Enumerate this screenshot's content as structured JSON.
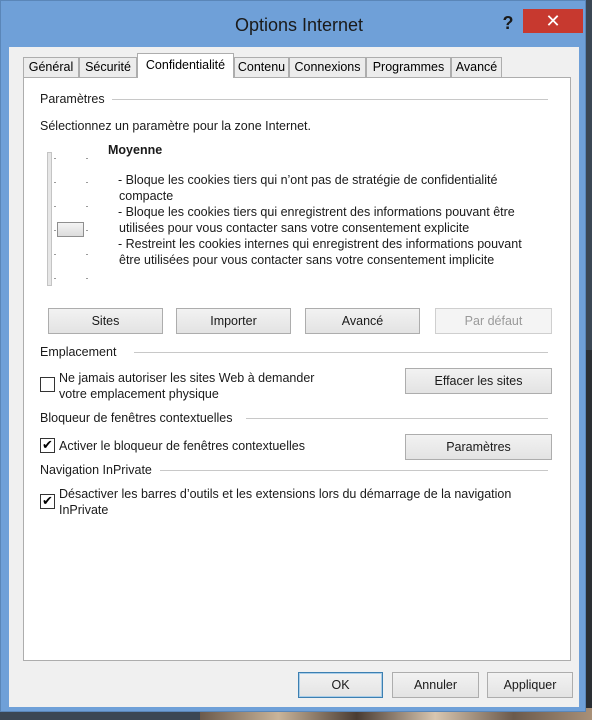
{
  "window": {
    "title": "Options Internet",
    "help_label": "?",
    "close_label": "✕"
  },
  "tabs": [
    {
      "label": "Général"
    },
    {
      "label": "Sécurité"
    },
    {
      "label": "Confidentialité"
    },
    {
      "label": "Contenu"
    },
    {
      "label": "Connexions"
    },
    {
      "label": "Programmes"
    },
    {
      "label": "Avancé"
    }
  ],
  "active_tab": "Confidentialité",
  "settings": {
    "group_label": "Paramètres",
    "instruction": "Sélectionnez un paramètre pour la zone Internet.",
    "level_title": "Moyenne",
    "level_desc": [
      "- Bloque les cookies tiers qui n’ont pas de stratégie de confidentialité",
      "compacte",
      "- Bloque les cookies tiers qui enregistrent des informations pouvant être",
      "utilisées pour vous contacter sans votre consentement explicite",
      "- Restreint les cookies internes qui enregistrent des informations pouvant",
      "être utilisées pour vous contacter sans votre consentement implicite"
    ],
    "buttons": {
      "sites": "Sites",
      "import": "Importer",
      "advanced": "Avancé",
      "default": "Par défaut"
    }
  },
  "location": {
    "group_label": "Emplacement",
    "checkbox_line1": "Ne jamais autoriser les sites Web à demander",
    "checkbox_line2": "votre emplacement physique",
    "checked": false,
    "clear_button": "Effacer les sites"
  },
  "popup": {
    "group_label": "Bloqueur de fenêtres contextuelles",
    "checkbox_label": "Activer le bloqueur de fenêtres contextuelles",
    "checked": true,
    "settings_button": "Paramètres"
  },
  "inprivate": {
    "group_label": "Navigation InPrivate",
    "checkbox_line1": "Désactiver les barres d’outils et les extensions lors du démarrage de la navigation",
    "checkbox_line2": "InPrivate",
    "checked": true
  },
  "footer": {
    "ok": "OK",
    "cancel": "Annuler",
    "apply": "Appliquer"
  },
  "check_glyph": "✔"
}
